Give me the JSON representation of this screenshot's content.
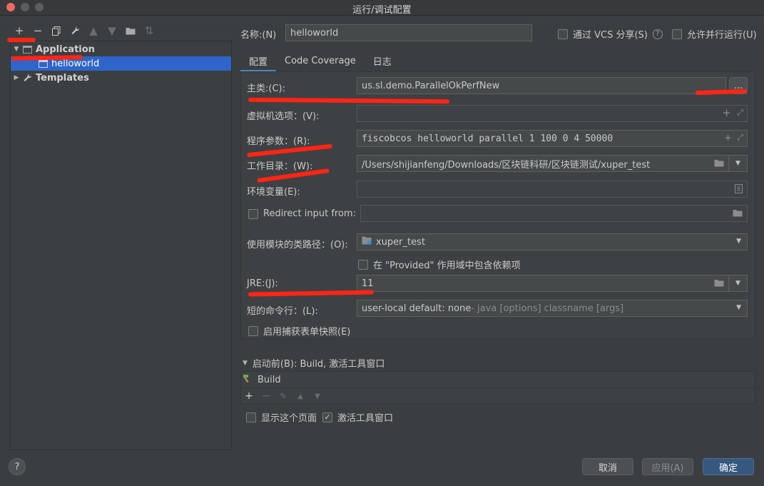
{
  "window": {
    "title": "运行/调试配置"
  },
  "toolbar": {
    "icons": [
      "add-icon",
      "remove-icon",
      "copy-icon",
      "wrench-icon",
      "move-up-icon",
      "move-down-icon",
      "folder-icon",
      "sort-icon"
    ]
  },
  "tree": {
    "application": "Application",
    "helloworld": "helloworld",
    "templates": "Templates"
  },
  "header": {
    "name_label": "名称:(N)",
    "name_value": "helloworld",
    "vcs_label": "通过 VCS 分享(S)",
    "parallel_label": "允许并行运行(U)"
  },
  "tabs": [
    "配置",
    "Code Coverage",
    "日志"
  ],
  "form": {
    "main_class_label": "主类:(C):",
    "main_class_value": "us.sl.demo.ParallelOkPerfNew",
    "browse_label": "...",
    "vm_label": "虚拟机选项：(V):",
    "vm_value": "",
    "args_label": "程序参数：(R):",
    "args_value": "fiscobcos helloworld parallel 1 100 0 4 50000",
    "workdir_label": "工作目录：(W):",
    "workdir_value": "/Users/shijianfeng/Downloads/区块链科研/区块链测试/xuper_test",
    "env_label": "环境变量(E):",
    "env_value": "",
    "redirect_label": "Redirect input from:",
    "module_label": "使用模块的类路径：(O):",
    "module_value": "xuper_test",
    "provided_label": "在 \"Provided\" 作用域中包含依赖项",
    "jre_label": "JRE:(J):",
    "jre_value": "11",
    "shorten_label": "短的命令行：(L):",
    "shorten_value": "user-local default: none",
    "shorten_hint": " - java [options] classname [args]",
    "snapshot_label": "启用捕获表单快照(E)"
  },
  "before_launch": {
    "title": "启动前(B): Build, 激活工具窗口",
    "item": "Build",
    "show_page_label": "显示这个页面",
    "activate_label": "激活工具窗口"
  },
  "buttons": {
    "help": "?",
    "cancel": "取消",
    "apply": "应用(A)",
    "ok": "确定"
  },
  "colors": {
    "accent": "#2f65ca",
    "primary_button": "#365880",
    "annotation": "#ff2414"
  }
}
